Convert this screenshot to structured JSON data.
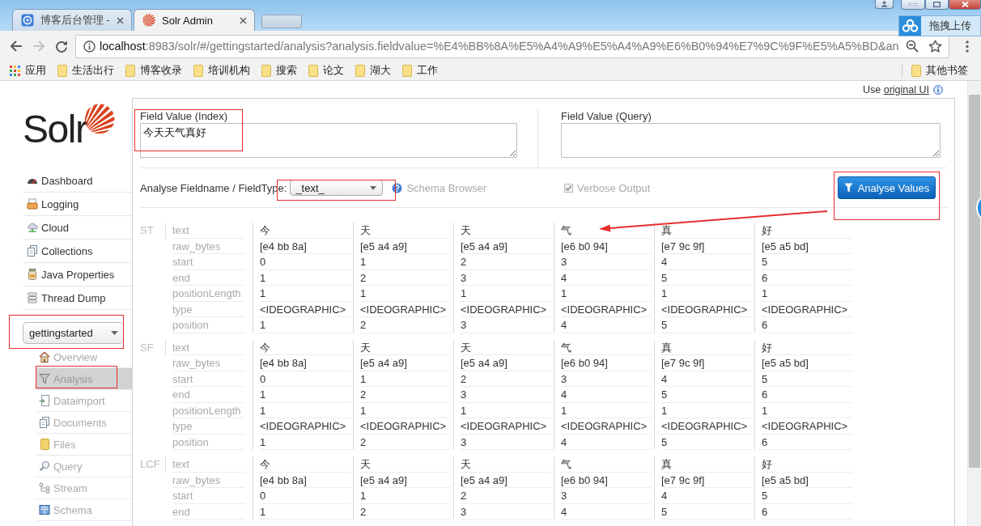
{
  "browser": {
    "tabs": [
      {
        "title": "博客后台管理 -",
        "kind": "blog",
        "selected": false
      },
      {
        "title": "Solr Admin",
        "kind": "solr",
        "selected": true
      }
    ],
    "upload_button": "拖拽上传",
    "nav_buttons": [
      {
        "kind": "back",
        "disabled": false
      },
      {
        "kind": "forward",
        "disabled": true
      },
      {
        "kind": "reload",
        "disabled": false
      }
    ],
    "url": {
      "host": "localhost",
      "rest": ":8983/solr/#/gettingstarted/analysis?analysis.fieldvalue=%E4%BB%8A%E5%A4%A9%E5%A4%A9%E6%B0%94%E7%9C%9F%E5%A5%BD&an"
    },
    "bookmarks": [
      {
        "label": "应用",
        "kind": "apps"
      },
      {
        "label": "生活出行",
        "kind": "folder"
      },
      {
        "label": "博客收录",
        "kind": "folder"
      },
      {
        "label": "培训机构",
        "kind": "folder"
      },
      {
        "label": "搜索",
        "kind": "folder"
      },
      {
        "label": "论文",
        "kind": "folder"
      },
      {
        "label": "湖大",
        "kind": "folder"
      },
      {
        "label": "工作",
        "kind": "folder"
      }
    ],
    "other_bookmarks": "其他书签"
  },
  "sidebar": {
    "logo": "Solr",
    "items": [
      {
        "label": "Dashboard",
        "kind": "dashboard"
      },
      {
        "label": "Logging",
        "kind": "logging"
      },
      {
        "label": "Cloud",
        "kind": "cloud"
      },
      {
        "label": "Collections",
        "kind": "collections"
      },
      {
        "label": "Java Properties",
        "kind": "java"
      },
      {
        "label": "Thread Dump",
        "kind": "threads"
      }
    ],
    "core": "gettingstarted",
    "core_items": [
      {
        "label": "Overview",
        "kind": "overview",
        "selected": false
      },
      {
        "label": "Analysis",
        "kind": "analysis",
        "selected": true
      },
      {
        "label": "Dataimport",
        "kind": "dataimport",
        "selected": false
      },
      {
        "label": "Documents",
        "kind": "documents",
        "selected": false
      },
      {
        "label": "Files",
        "kind": "files",
        "selected": false
      },
      {
        "label": "Query",
        "kind": "query",
        "selected": false
      },
      {
        "label": "Stream",
        "kind": "stream",
        "selected": false
      },
      {
        "label": "Schema",
        "kind": "schema",
        "selected": false
      }
    ]
  },
  "main": {
    "ui_note": "Use",
    "ui_link": "original UI",
    "index_field": {
      "label": "Field Value (Index)",
      "value": "今天天气真好"
    },
    "query_field": {
      "label": "Field Value (Query)"
    },
    "fieldtype": {
      "label": "Analyse Fieldname / FieldType:",
      "value": "_text_"
    },
    "schema_browser": "Schema Browser",
    "verbose": {
      "label": "Verbose Output",
      "checked": true
    },
    "analyse_button": "Analyse Values"
  },
  "analysis": {
    "stages": [
      {
        "name": "ST",
        "rows": [
          {
            "label": "text",
            "cells": [
              "今",
              "天",
              "天",
              "气",
              "真",
              "好"
            ]
          },
          {
            "label": "raw_bytes",
            "cells": [
              "[e4 bb 8a]",
              "[e5 a4 a9]",
              "[e5 a4 a9]",
              "[e6 b0 94]",
              "[e7 9c 9f]",
              "[e5 a5 bd]"
            ]
          },
          {
            "label": "start",
            "cells": [
              "0",
              "1",
              "2",
              "3",
              "4",
              "5"
            ]
          },
          {
            "label": "end",
            "cells": [
              "1",
              "2",
              "3",
              "4",
              "5",
              "6"
            ]
          },
          {
            "label": "positionLength",
            "cells": [
              "1",
              "1",
              "1",
              "1",
              "1",
              "1"
            ]
          },
          {
            "label": "type",
            "cells": [
              "<IDEOGRAPHIC>",
              "<IDEOGRAPHIC>",
              "<IDEOGRAPHIC>",
              "<IDEOGRAPHIC>",
              "<IDEOGRAPHIC>",
              "<IDEOGRAPHIC>"
            ]
          },
          {
            "label": "position",
            "cells": [
              "1",
              "2",
              "3",
              "4",
              "5",
              "6"
            ]
          }
        ]
      },
      {
        "name": "SF",
        "rows": [
          {
            "label": "text",
            "cells": [
              "今",
              "天",
              "天",
              "气",
              "真",
              "好"
            ]
          },
          {
            "label": "raw_bytes",
            "cells": [
              "[e4 bb 8a]",
              "[e5 a4 a9]",
              "[e5 a4 a9]",
              "[e6 b0 94]",
              "[e7 9c 9f]",
              "[e5 a5 bd]"
            ]
          },
          {
            "label": "start",
            "cells": [
              "0",
              "1",
              "2",
              "3",
              "4",
              "5"
            ]
          },
          {
            "label": "end",
            "cells": [
              "1",
              "2",
              "3",
              "4",
              "5",
              "6"
            ]
          },
          {
            "label": "positionLength",
            "cells": [
              "1",
              "1",
              "1",
              "1",
              "1",
              "1"
            ]
          },
          {
            "label": "type",
            "cells": [
              "<IDEOGRAPHIC>",
              "<IDEOGRAPHIC>",
              "<IDEOGRAPHIC>",
              "<IDEOGRAPHIC>",
              "<IDEOGRAPHIC>",
              "<IDEOGRAPHIC>"
            ]
          },
          {
            "label": "position",
            "cells": [
              "1",
              "2",
              "3",
              "4",
              "5",
              "6"
            ]
          }
        ]
      },
      {
        "name": "LCF",
        "rows": [
          {
            "label": "text",
            "cells": [
              "今",
              "天",
              "天",
              "气",
              "真",
              "好"
            ]
          },
          {
            "label": "raw_bytes",
            "cells": [
              "[e4 bb 8a]",
              "[e5 a4 a9]",
              "[e5 a4 a9]",
              "[e6 b0 94]",
              "[e7 9c 9f]",
              "[e5 a5 bd]"
            ]
          },
          {
            "label": "start",
            "cells": [
              "0",
              "1",
              "2",
              "3",
              "4",
              "5"
            ]
          },
          {
            "label": "end",
            "cells": [
              "1",
              "2",
              "3",
              "4",
              "5",
              "6"
            ]
          }
        ]
      }
    ]
  }
}
